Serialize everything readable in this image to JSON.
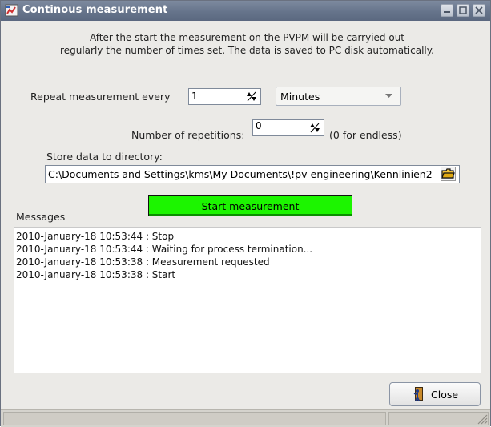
{
  "window": {
    "title": "Continous measurement"
  },
  "description": {
    "line1": "After the start the measurement on the PVPM will be carryied out",
    "line2": "regularly the number of times set. The data is saved to PC disk automatically."
  },
  "repeat": {
    "label": "Repeat measurement every",
    "value": "1",
    "unit": "Minutes"
  },
  "repetitions": {
    "label": "Number of repetitions:",
    "value": "0",
    "hint": "(0 for endless)"
  },
  "directory": {
    "label": "Store data to directory:",
    "value": "C:\\Documents and Settings\\kms\\My Documents\\!pv-engineering\\Kennlinien2"
  },
  "start_button": {
    "label": "Start measurement"
  },
  "messages": {
    "label": "Messages",
    "items": [
      "2010-January-18 10:53:44 : Stop",
      "2010-January-18 10:53:44 : Waiting for process termination...",
      "2010-January-18 10:53:38 : Measurement requested",
      "2010-January-18 10:53:38 : Start"
    ]
  },
  "close_button": {
    "label": "Close"
  },
  "colors": {
    "start_button": "#1cf500",
    "titlebar": "#66748b"
  }
}
